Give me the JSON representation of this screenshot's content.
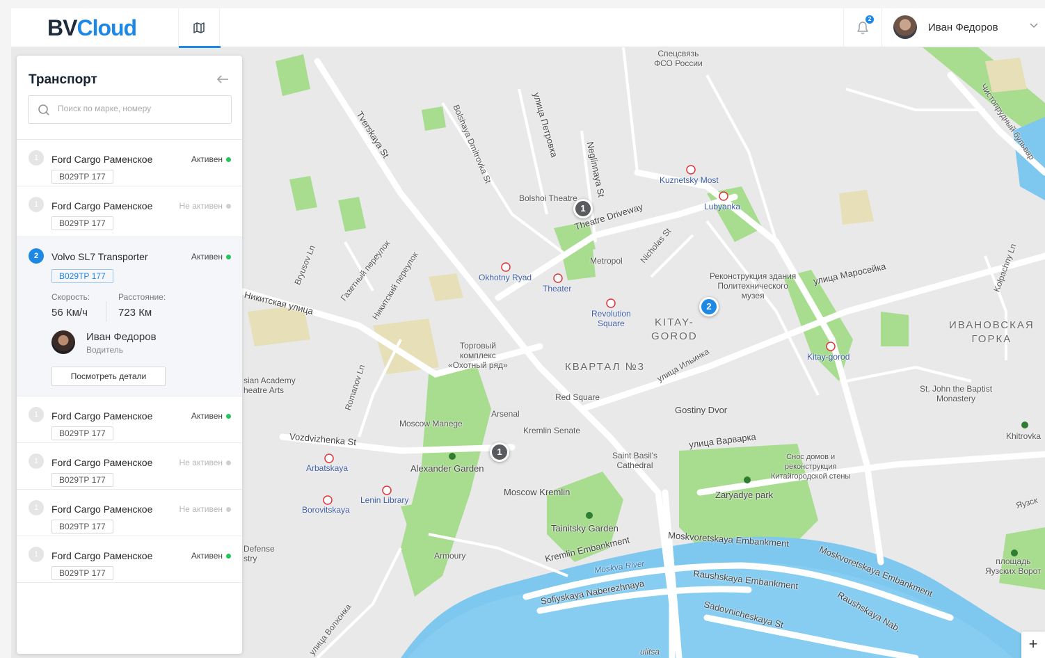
{
  "header": {
    "logo_a": "BV",
    "logo_b": "Cloud",
    "nav_map_icon": "map-icon",
    "notifications_count": "2",
    "user_name": "Иван Федоров"
  },
  "sidebar": {
    "title": "Транспорт",
    "search_placeholder": "Поиск по марке, номеру",
    "vehicles": [
      {
        "num": "1",
        "name": "Ford Cargo Раменское",
        "status": "Активен",
        "active": true,
        "plate": "В029ТР 177"
      },
      {
        "num": "1",
        "name": "Ford Cargo Раменское",
        "status": "Не активен",
        "active": false,
        "plate": "В029ТР 177"
      },
      {
        "num": "2",
        "name": "Volvo SL7 Transporter",
        "status": "Активен",
        "active": true,
        "plate": "В029ТР 177",
        "speed_label": "Скорость:",
        "speed_value": "56 Км/ч",
        "distance_label": "Расстояние:",
        "distance_value": "723 Км",
        "driver_name": "Иван Федоров",
        "driver_role": "Водитель",
        "details_button": "Посмотреть детали"
      },
      {
        "num": "1",
        "name": "Ford Cargo Раменское",
        "status": "Активен",
        "active": true,
        "plate": "В029ТР 177"
      },
      {
        "num": "1",
        "name": "Ford Cargo Раменское",
        "status": "Не активен",
        "active": false,
        "plate": "В029ТР 177"
      },
      {
        "num": "1",
        "name": "Ford Cargo Раменское",
        "status": "Не активен",
        "active": false,
        "plate": "В029ТР 177"
      },
      {
        "num": "1",
        "name": "Ford Cargo Раменское",
        "status": "Активен",
        "active": true,
        "plate": "В029ТР 177"
      }
    ]
  },
  "map": {
    "clusters": [
      "1",
      "2",
      "1"
    ],
    "labels": {
      "spets": "Спецсвязь\nФСО России",
      "tverskaya": "Tverskaya St",
      "bdmitrovka": "Bolshaya Dmitrovka St",
      "petrovka": "улица Петровка",
      "neglinnaya": "Neglinnaya St",
      "kuznetsky": "Kuznetsky Most",
      "lubyanka": "Lubyanka",
      "chistoprud": "Чистопрудный бульвар",
      "bolshoi": "Bolshoi Theatre",
      "theatre_drive": "Theatre Driveway",
      "metropol": "Metropol",
      "nicholas": "Nicholas St",
      "okhotny": "Okhotny Ryad",
      "theater": "Theater",
      "revolution": "Revolution\nSquare",
      "kitay": "KITAY-\nGOROD",
      "polytech": "Реконструкция здания\nПолитехнического\nмузея",
      "maroseyka": "улица Маросейка",
      "kolpachny": "Kolpachny Ln",
      "ivanovskaya": "ИВАНОВСКАЯ\nГОРКА",
      "kitay_gorod": "Kitay-gorod",
      "bryusov": "Bryusov Ln",
      "gazetny": "Газетный переулок",
      "nikitsky_per": "Никитский переулок",
      "nikitskaya": "Никитская улица",
      "mall": "Торговый\nкомплекс\n«Охотный ряд»",
      "kvartal": "КВАРТАЛ №3",
      "ilyinka": "улица Ильинка",
      "academy": "sian Academy\nheatre Arts",
      "romanov": "Romanov Ln",
      "red_square": "Red Square",
      "gostiny": "Gostiny Dvor",
      "john": "St. John the Baptist\nMonastery",
      "manege": "Moscow Manege",
      "arsenal": "Arsenal",
      "senate": "Kremlin Senate",
      "vozdvizhenka": "Vozdvizhenka St",
      "varvarka": "улица Варварка",
      "khitrovka": "Khitrovka",
      "arbatskaya": "Arbatskaya",
      "alex_garden": "Alexander Garden",
      "st_basils": "Saint Basil's\nCathedral",
      "snos": "Снос домов и\nреконструкция\nКитайгородской стены",
      "lenin": "Lenin Library",
      "kremlin": "Moscow Kremlin",
      "zaryadye": "Zaryadye park",
      "borovitskaya": "Borovitskaya",
      "yauzsk": "Яузск",
      "tainitsky": "Tainitsky Garden",
      "defense": "Defense\nstry",
      "armoury": "Armoury",
      "kremlin_emb": "Kremlin Embankment",
      "moskvoretskaya": "Moskvoretskaya Embankment",
      "moskvoretskaya2": "Moskvoretskaya Embankment",
      "moskva": "Moskva River",
      "ploshad": "площадь\nЯузских Ворот",
      "raushskaya": "Raushskaya Embankment",
      "sofiyskaya": "Sofiyskaya Naberezhnaya",
      "raushskaya_nab": "Raushskaya Nab.",
      "sadovnicheskaya": "Sadovnicheskaya St",
      "volkhonka": "улица Волхонка",
      "ulitsa": "ulitsa"
    },
    "zoom_in": "+",
    "zoom_out": "−"
  },
  "colors": {
    "accent": "#1e88e5",
    "active_dot": "#22c55e",
    "inactive_dot": "#cfcfcf",
    "water": "#7ec8ef",
    "park": "#a8dc8f"
  }
}
